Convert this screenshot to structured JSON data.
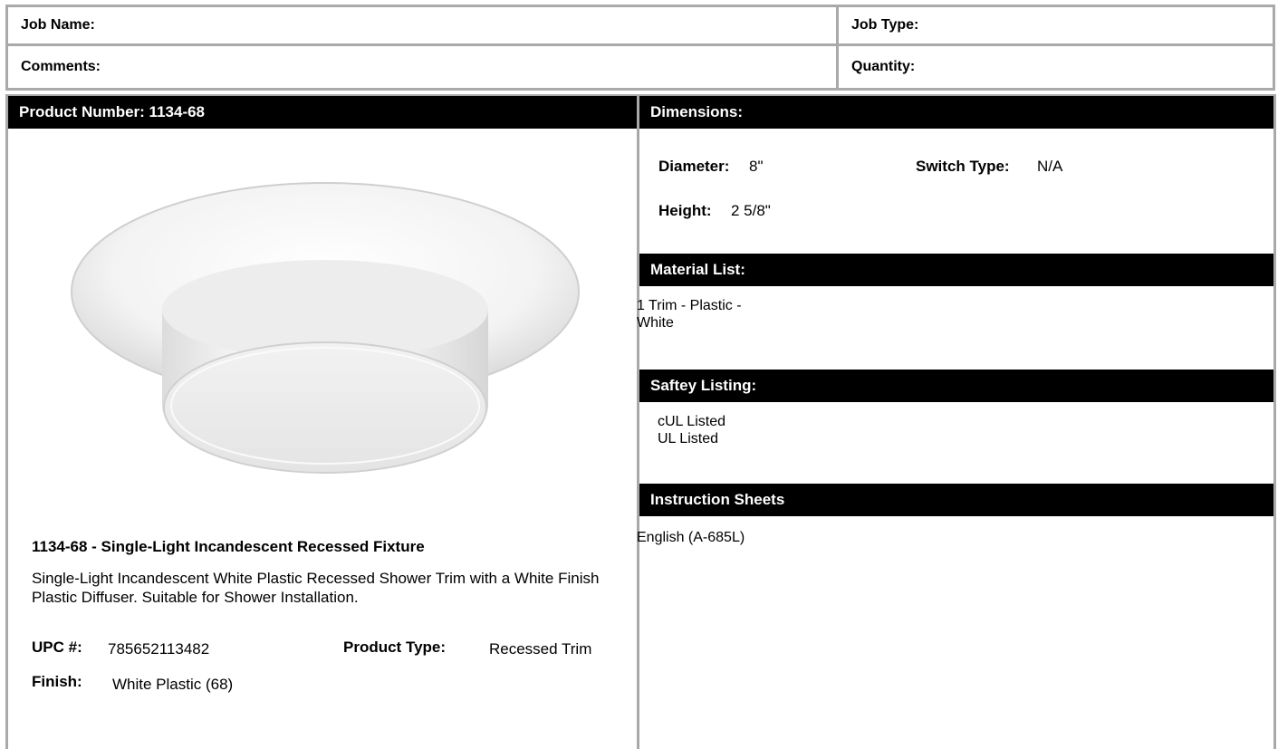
{
  "job": {
    "name_label": "Job Name:",
    "type_label": "Job Type:",
    "comments_label": "Comments:",
    "quantity_label": "Quantity:"
  },
  "product": {
    "number_header": "Product Number: 1134-68",
    "image_name": "recessed-shower-trim-fixture",
    "title": "1134-68 - Single-Light Incandescent Recessed Fixture",
    "description": "Single-Light Incandescent White Plastic Recessed Shower Trim with a White Finish Plastic Diffuser. Suitable for Shower Installation.",
    "upc_label": "UPC #:",
    "upc_value": "785652113482",
    "type_label": "Product Type:",
    "type_value": "Recessed Trim",
    "finish_label": "Finish:",
    "finish_value": "White Plastic (68)"
  },
  "dimensions": {
    "header": "Dimensions:",
    "diameter_label": "Diameter:",
    "diameter_value": "8\"",
    "switch_label": "Switch Type:",
    "switch_value": "N/A",
    "height_label": "Height:",
    "height_value": "2 5/8\""
  },
  "material": {
    "header": "Material List:",
    "line1": "1 Trim - Plastic -",
    "line2": "White"
  },
  "safety": {
    "header": "Saftey Listing:",
    "line1": "cUL Listed",
    "line2": "UL Listed"
  },
  "instructions": {
    "header": "Instruction Sheets",
    "link": "English (A-685L)"
  },
  "colors": {
    "header_bg": "#000000",
    "header_text": "#ffffff",
    "border": "#a9a9a9"
  }
}
